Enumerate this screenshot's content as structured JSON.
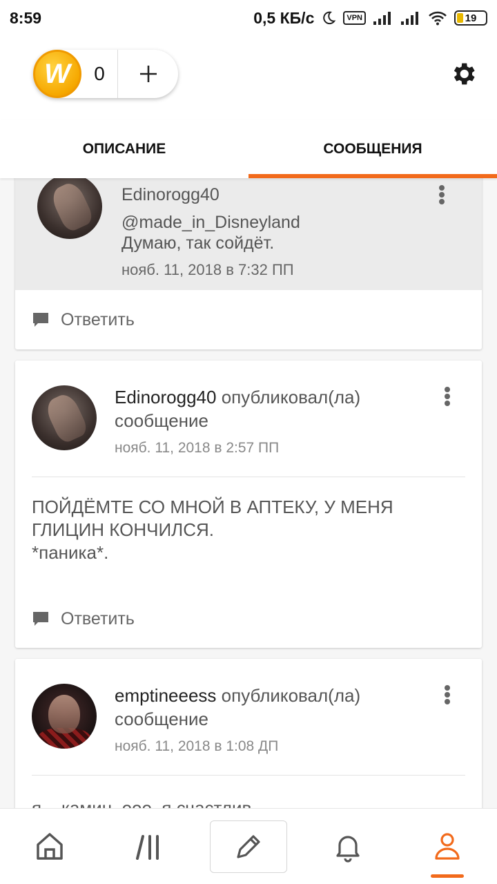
{
  "status_bar": {
    "time": "8:59",
    "net_speed": "0,5 КБ/с",
    "vpn_label": "VPN",
    "battery": "19"
  },
  "header": {
    "coin_logo_letter": "W",
    "coin_count": "0",
    "accent_color": "#f26a1b"
  },
  "tabs": [
    {
      "label": "ОПИСАНИЕ",
      "active": false
    },
    {
      "label": "СООБЩЕНИЯ",
      "active": true
    }
  ],
  "feed": {
    "reply_card": {
      "username": "Edinorogg40",
      "mention": "@made_in_Disneyland",
      "text": "Думаю, так сойдёт.",
      "timestamp": "нояб. 11, 2018 в 7:32 ПП",
      "reply_label": "Ответить"
    },
    "posts": [
      {
        "username": "Edinorogg40",
        "action": "опубликовал(ла) сообщение",
        "timestamp": "нояб. 11, 2018 в 2:57 ПП",
        "body": "ПОЙДЁМТЕ СО МНОЙ В АПТЕКУ, У МЕНЯ ГЛИЦИН КОНЧИЛСЯ.\n*паника*.",
        "reply_label": "Ответить"
      },
      {
        "username": "emptineeess",
        "action": "опубликовал(ла) сообщение",
        "timestamp": "нояб. 11, 2018 в 1:08 ДП",
        "body": "я – камин, ооо, я счастлив"
      }
    ]
  },
  "bottom_nav": [
    {
      "icon": "home-icon",
      "active": false
    },
    {
      "icon": "library-icon",
      "active": false
    },
    {
      "icon": "pencil-icon",
      "active": false
    },
    {
      "icon": "bell-icon",
      "active": false
    },
    {
      "icon": "profile-icon",
      "active": true
    }
  ]
}
